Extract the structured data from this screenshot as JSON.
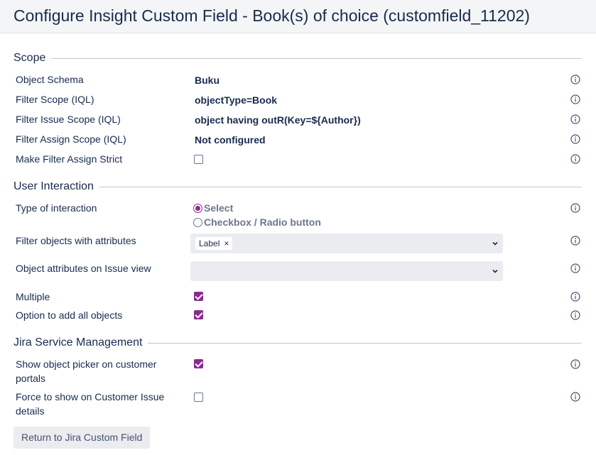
{
  "title": "Configure Insight Custom Field - Book(s) of choice (customfield_11202)",
  "sections": {
    "scope": "Scope",
    "user_interaction": "User Interaction",
    "jsm": "Jira Service Management"
  },
  "scope": {
    "object_schema": {
      "label": "Object Schema",
      "value": "Buku"
    },
    "filter_scope": {
      "label": "Filter Scope (IQL)",
      "value": "objectType=Book"
    },
    "filter_issue_scope": {
      "label": "Filter Issue Scope (IQL)",
      "value": "object having outR(Key=${Author})"
    },
    "filter_assign_scope": {
      "label": "Filter Assign Scope (IQL)",
      "value": "Not configured"
    },
    "make_filter_assign_strict": {
      "label": "Make Filter Assign Strict",
      "checked": false
    }
  },
  "user_interaction": {
    "type_of_interaction": {
      "label": "Type of interaction",
      "options": [
        "Select",
        "Checkbox / Radio button"
      ],
      "selected": "Select"
    },
    "filter_objects_with_attributes": {
      "label": "Filter objects with attributes",
      "chips": [
        "Label"
      ]
    },
    "object_attributes_on_issue_view": {
      "label": "Object attributes on Issue view",
      "chips": []
    },
    "multiple": {
      "label": "Multiple",
      "checked": true
    },
    "add_all_objects": {
      "label": "Option to add all objects",
      "checked": true
    }
  },
  "jsm": {
    "show_picker": {
      "label_line1": "Show object picker on customer",
      "label_line2": "portals",
      "checked": true
    },
    "force_show": {
      "label_line1": "Force to show on Customer Issue",
      "label_line2": "details",
      "checked": false
    }
  },
  "buttons": {
    "return": "Return to Jira Custom Field"
  },
  "colors": {
    "accent": "#8a2b8f",
    "header_bg": "#f4f5f7",
    "text": "#172b4d",
    "field_bg": "#ebecf0"
  },
  "icons": {
    "info": "info-icon",
    "chevron": "chevron-down-icon",
    "remove": "close-icon"
  }
}
